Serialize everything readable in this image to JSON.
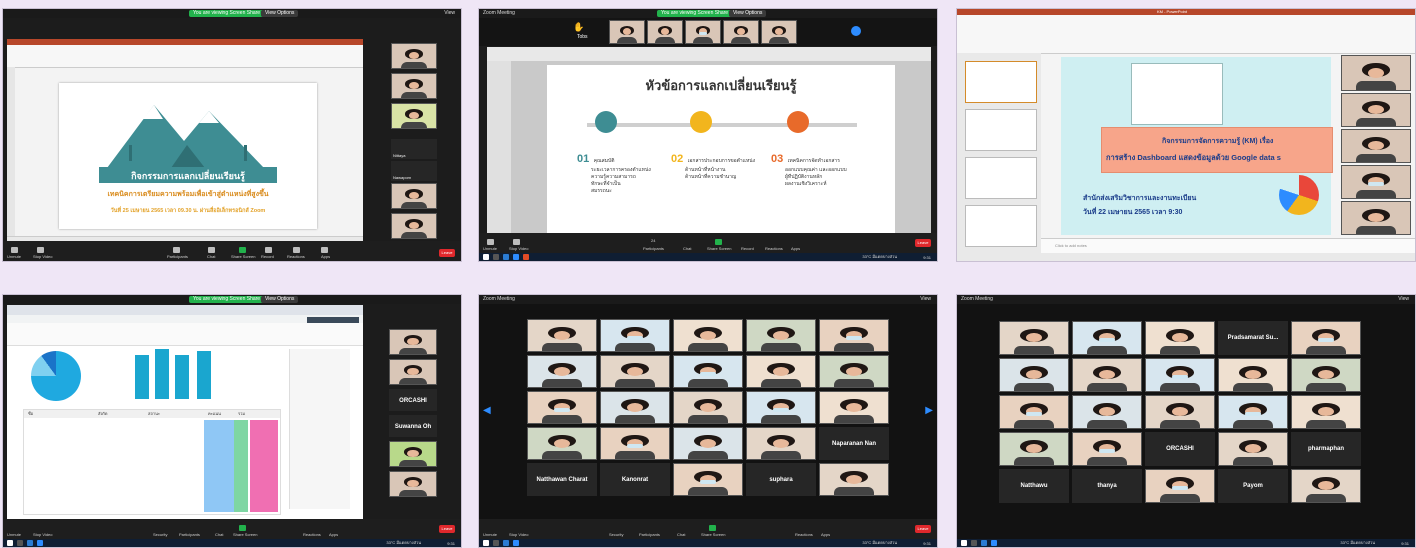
{
  "zoom": {
    "screen_share_label": "You are viewing Screen Share",
    "view_options": "View Options",
    "meeting_title": "Zoom Meeting",
    "leave": "Leave",
    "view": "View",
    "controls": [
      "Unmute",
      "Stop Video",
      "Security",
      "Participants",
      "Chat",
      "Share Screen",
      "Record",
      "Reactions",
      "Apps"
    ],
    "participant_count": "24",
    "weather": "33°C มีแดดบางส่วน",
    "time": "9:31"
  },
  "panel1": {
    "slide_title": "กิจกรรมการแลกเปลี่ยนเรียนรู้",
    "slide_subtitle": "เทคนิคการเตรียมความพร้อมเพื่อเข้าสู่ตำแหน่งที่สูงขึ้น",
    "slide_date": "วันที่ 25 เมษายน 2565 เวลา 09.30 น. ผ่านสื่ออิเล็กทรอนิกส์ Zoom",
    "side_names": [
      "Nittaya",
      "Nawaporn"
    ]
  },
  "panel2": {
    "toolbar_name": "Tobs",
    "slide_title": "หัวข้อการแลกเปลี่ยนเรียนรู้",
    "sections": [
      {
        "num": "01",
        "head": "คุณสมบัติ",
        "items": [
          "ระยะเวลาการครองตำแหน่ง",
          "ความรู้ความสามารถ",
          "ทักษะที่จำเป็น",
          "สมรรถนะ"
        ]
      },
      {
        "num": "02",
        "head": "เอกสารประกอบการขอตำแหน่ง",
        "items": [
          "ด้านหน้าที่หน้างาน",
          "ด้านหน้าที่ความชำนาญ"
        ]
      },
      {
        "num": "03",
        "head": "เทคนิคการจัดทำเอกสาร",
        "items": [
          "ออกแบบคุณค่า และออกแบบ",
          "ผู้ทีปฏิบัติงานหลัก",
          "ผลงานเชิงวิเคราะห์"
        ]
      }
    ]
  },
  "panel3": {
    "app_title": "KM - PowerPoint",
    "title_line1": "กิจกรรมการจัดการความรู้ (KM) เรื่อง",
    "title_line2": "การสร้าง Dashboard แสดงข้อมูลด้วย Google data s",
    "org": "สำนักส่งเสริมวิชาการและงานทะเบียน",
    "date": "วันที่ 22 เมษายน 2565 เวลา 9:30",
    "notes": "Click to add notes"
  },
  "panel4": {
    "side_names": [
      "ORCASHI",
      "Suwanna Oh"
    ],
    "table_headers": [
      "ชื่อ",
      "สังกัด",
      "สถานะ",
      "คะแนน",
      "รวม"
    ]
  },
  "panel5": {
    "names": [
      "Natthawan Charat",
      "Kanonrat",
      "suphara",
      "Naparanan Nan"
    ]
  },
  "panel6": {
    "names": [
      "Pradsamarat Su...",
      "ORCASHI",
      "pharmaphan",
      "Natthawu",
      "thanya",
      "Payom"
    ]
  },
  "colors": {
    "zoom_green": "#22b24c",
    "leave_red": "#e0282c",
    "teal": "#3e8d93",
    "orange": "#e89a2a"
  }
}
